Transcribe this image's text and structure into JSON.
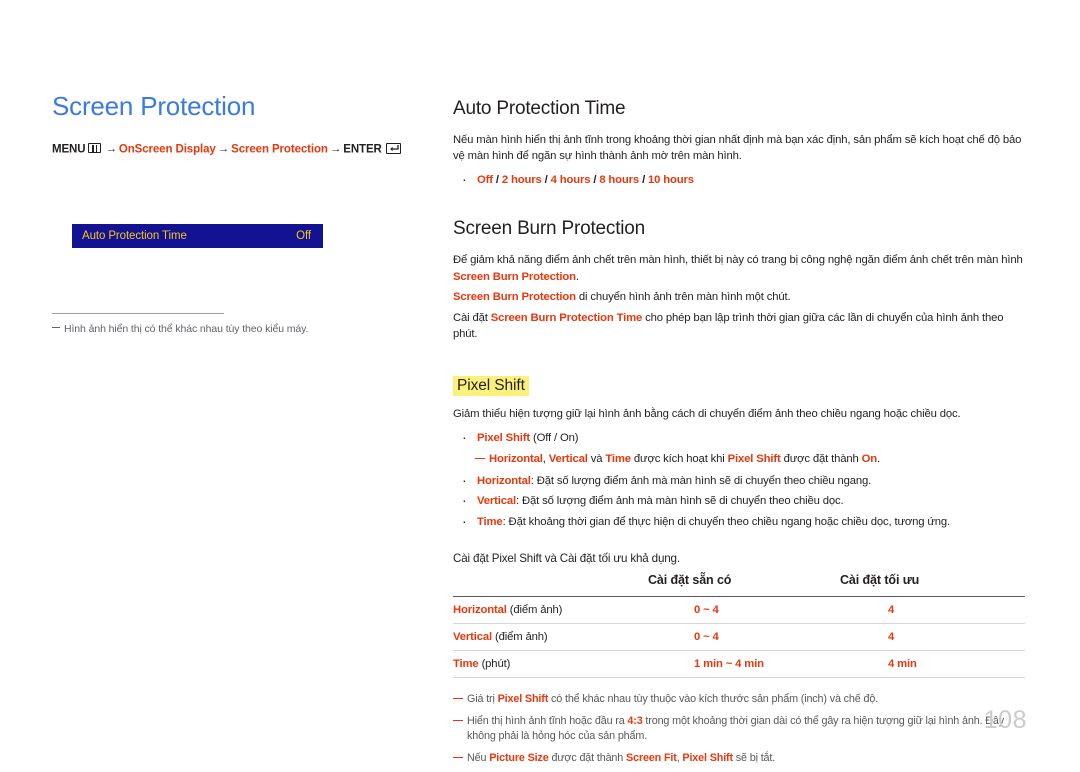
{
  "left": {
    "title": "Screen Protection",
    "menu_path": {
      "menu_label": "MENU",
      "menu_icon": "menu-grid-icon",
      "arrow": "→",
      "step1": "OnScreen Display",
      "step2": "Screen Protection",
      "enter_label": "ENTER",
      "enter_icon": "enter-key-icon"
    },
    "osd": {
      "label": "Auto Protection Time",
      "value": "Off",
      "bg_color": "#121292",
      "text_color": "#f5c518"
    },
    "note": "Hình ảnh hiển thị có thể khác nhau tùy theo kiểu máy."
  },
  "right": {
    "auto_protection": {
      "title": "Auto Protection Time",
      "paragraph": "Nếu màn hình hiển thị ảnh tĩnh trong khoảng thời gian nhất định mà bạn xác định, sản phẩm sẽ kích hoạt chế độ bảo vệ màn hình để ngăn sự hình thành ảnh mờ trên màn hình.",
      "options": [
        "Off",
        "2 hours",
        "4 hours",
        "8 hours",
        "10 hours"
      ],
      "options_sep": " / "
    },
    "screen_burn": {
      "title": "Screen Burn Protection",
      "p1_a": "Để giảm khả năng điểm ảnh chết trên màn hình, thiết bị này có trang bị công nghệ ngăn điểm ảnh chết trên màn hình ",
      "p1_term": "Screen Burn Protection",
      "p1_b": ".",
      "p2_term": "Screen Burn Protection",
      "p2_b": " di chuyển hình ảnh trên màn hình một chút.",
      "p3_a": "Cài đặt ",
      "p3_term": "Screen Burn Protection Time",
      "p3_b": " cho phép bạn lập trình thời gian giữa các lần di chuyển của hình ảnh theo phút."
    },
    "pixel_shift": {
      "title": "Pixel Shift",
      "highlight_color": "#fbf07a",
      "intro": "Giảm thiểu hiện tượng giữ lại hình ảnh bằng cách di chuyển điểm ảnh theo chiều ngang hoặc chiều dọc.",
      "bullet_main_term": "Pixel Shift",
      "bullet_main_rest": " (Off / On)",
      "subnote": {
        "t1": "Horizontal",
        "sep1": ", ",
        "t2": "Vertical",
        "sep2": " và ",
        "t3": "Time",
        "mid": " được kích hoạt khi ",
        "t4": "Pixel Shift",
        "mid2": " được đặt thành ",
        "t5": "On",
        "end": "."
      },
      "bullets": [
        {
          "term": "Horizontal",
          "text": ": Đặt số lượng điểm ảnh mà màn hình sẽ di chuyển theo chiều ngang."
        },
        {
          "term": "Vertical",
          "text": ": Đặt số lượng điểm ảnh mà màn hình sẽ di chuyển theo chiều dọc."
        },
        {
          "term": "Time",
          "text": ": Đặt khoảng thời gian để thực hiện di chuyển theo chiều ngang hoặc chiều dọc, tương ứng."
        }
      ]
    },
    "table": {
      "lead": "Cài đặt Pixel Shift và Cài đặt tối ưu khả dụng.",
      "headers": [
        "",
        "Cài đặt sẵn có",
        "Cài đặt tối ưu"
      ],
      "rows": [
        {
          "term": "Horizontal",
          "unit": " (điểm ảnh)",
          "available": "0 ~ 4",
          "optimum": "4"
        },
        {
          "term": "Vertical",
          "unit": " (điểm ảnh)",
          "available": "0 ~ 4",
          "optimum": "4"
        },
        {
          "term": "Time",
          "unit": " (phút)",
          "available": "1 min ~ 4 min",
          "optimum": "4 min"
        }
      ]
    },
    "footnotes": [
      {
        "a": "Giá trị ",
        "term": "Pixel Shift",
        "b": " có thể khác nhau tùy thuộc vào kích thước sản phẩm (inch) và chế độ."
      },
      {
        "a": "Hiển thị hình ảnh tĩnh hoặc đầu ra ",
        "term": "4:3",
        "b": " trong một khoảng thời gian dài có thể gây ra hiện tượng giữ lại hình ảnh. Đây không phải là hỏng hóc của sản phẩm."
      },
      {
        "a": "Nếu ",
        "term": "Picture Size",
        "b": " được đặt thành ",
        "term2": "Screen Fit",
        "c": ", ",
        "term3": "Pixel Shift",
        "d": " sẽ bị tắt."
      }
    ]
  },
  "page_number": "108"
}
